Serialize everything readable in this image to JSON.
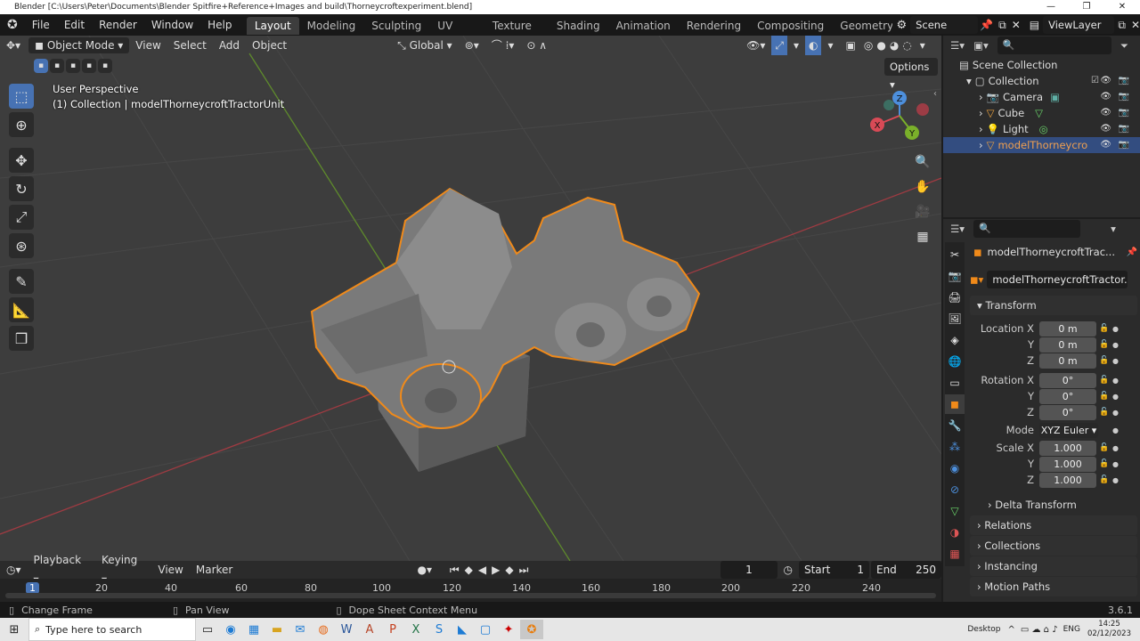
{
  "window": {
    "title": "Blender [C:\\Users\\Peter\\Documents\\Blender Spitfire+Reference+Images and build\\Thorneycroftexperiment.blend]"
  },
  "menu": [
    "File",
    "Edit",
    "Render",
    "Window",
    "Help"
  ],
  "workspaces": [
    "Layout",
    "Modeling",
    "Sculpting",
    "UV Editing",
    "Texture Paint",
    "Shading",
    "Animation",
    "Rendering",
    "Compositing",
    "Geometry Node"
  ],
  "scene": "Scene",
  "viewlayer": "ViewLayer",
  "viewport": {
    "mode": "Object Mode",
    "menus": [
      "View",
      "Select",
      "Add",
      "Object"
    ],
    "orientation": "Global",
    "options": "Options",
    "perspective": "User Perspective",
    "collection_info": "(1) Collection | modelThorneycroftTractorUnit",
    "gizmo": {
      "x": "X",
      "y": "Y",
      "z": "Z"
    }
  },
  "outliner": {
    "root": "Scene Collection",
    "collection": "Collection",
    "items": [
      "Camera",
      "Cube",
      "Light",
      "modelThorneycro"
    ]
  },
  "properties": {
    "object_name": "modelThorneycroftTrac...",
    "data_name": "modelThorneycroftTractor...",
    "transform_title": "Transform",
    "location": {
      "label": "Location X",
      "x": "0 m",
      "y": "0 m",
      "z": "0 m"
    },
    "rotation": {
      "label": "Rotation X",
      "x": "0°",
      "y": "0°",
      "z": "0°"
    },
    "mode_label": "Mode",
    "mode_value": "XYZ Euler",
    "scale": {
      "label": "Scale X",
      "x": "1.000",
      "y": "1.000",
      "z": "1.000"
    },
    "axis_y": "Y",
    "axis_z": "Z",
    "delta": "Delta Transform",
    "panels": [
      "Relations",
      "Collections",
      "Instancing",
      "Motion Paths"
    ]
  },
  "timeline": {
    "menus": [
      "Playback",
      "Keying",
      "View",
      "Marker"
    ],
    "current_frame": "1",
    "start_label": "Start",
    "start": "1",
    "end_label": "End",
    "end": "250",
    "ticks": [
      "1",
      "20",
      "40",
      "60",
      "80",
      "100",
      "120",
      "140",
      "160",
      "180",
      "200",
      "220",
      "240"
    ]
  },
  "status": {
    "left": "Change Frame",
    "middle": "Pan View",
    "right": "Dope Sheet Context Menu",
    "version": "3.6.1"
  },
  "taskbar": {
    "search": "Type here to search",
    "desktop": "Desktop",
    "lang": "ENG",
    "time": "14:25",
    "date": "02/12/2023"
  }
}
